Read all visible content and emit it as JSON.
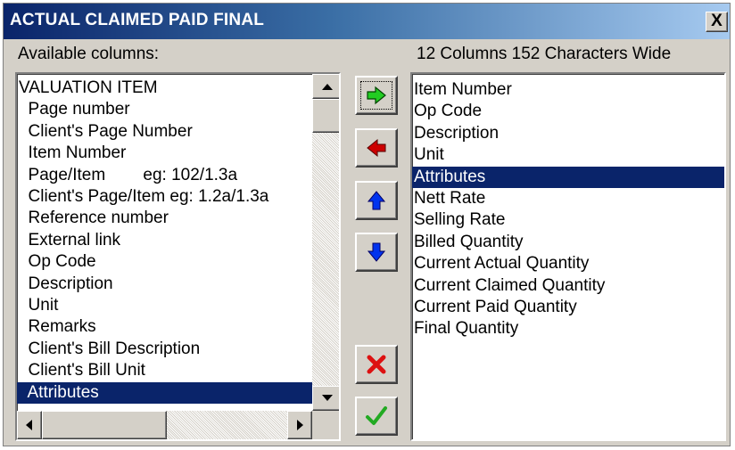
{
  "window": {
    "title": "ACTUAL CLAIMED PAID FINAL",
    "close_label": "X"
  },
  "labels": {
    "available": "Available columns:",
    "summary": "12 Columns 152 Characters Wide"
  },
  "available_columns": [
    "VALUATION ITEM",
    "  Page number",
    "  Client's Page Number",
    "  Item Number",
    "  Page/Item        eg: 102/1.3a",
    "  Client's Page/Item eg: 1.2a/1.3a",
    "  Reference number",
    "  External link",
    "  Op Code",
    "  Description",
    "  Unit",
    "  Remarks",
    "  Client's Bill Description",
    "  Client's Bill Unit",
    "  Attributes"
  ],
  "available_selected_index": 14,
  "selected_columns": [
    "Item Number",
    "Op Code",
    "Description",
    "Unit",
    "Attributes",
    "Nett Rate",
    "Selling Rate",
    "Billed Quantity",
    "Current Actual Quantity",
    "Current Claimed Quantity",
    "Current Paid Quantity",
    "Final Quantity"
  ],
  "selected_selected_index": 4,
  "toolbar": [
    {
      "name": "add-column-button",
      "icon": "arrow-right-green-icon"
    },
    {
      "name": "remove-column-button",
      "icon": "arrow-left-red-icon"
    },
    {
      "name": "move-up-button",
      "icon": "arrow-up-blue-icon"
    },
    {
      "name": "move-down-button",
      "icon": "arrow-down-blue-icon"
    },
    {
      "name": "cancel-button",
      "icon": "red-x-icon"
    },
    {
      "name": "ok-button",
      "icon": "green-check-icon"
    }
  ],
  "colors": {
    "title_gradient_start": "#0a246a",
    "title_gradient_end": "#a6caf0",
    "selection": "#0a246a",
    "face": "#d4d0c8"
  }
}
